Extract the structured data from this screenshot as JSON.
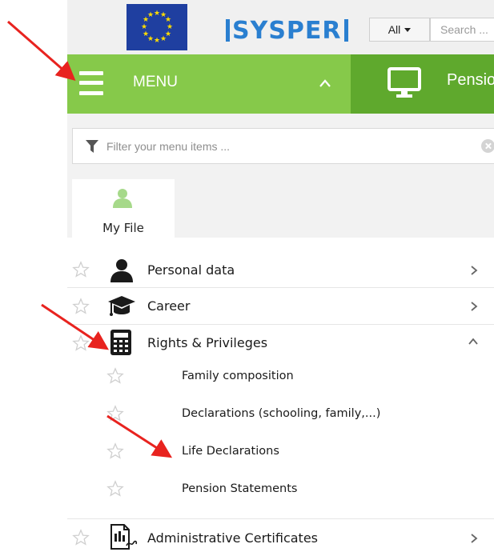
{
  "header": {
    "logo_text": "SYSPER",
    "search_scope": "All",
    "search_placeholder": "Search ..."
  },
  "menu_bar": {
    "label": "MENU",
    "pension_tab": "Pension"
  },
  "filter": {
    "placeholder": "Filter your menu items ..."
  },
  "tabs": [
    {
      "label": "My File"
    }
  ],
  "menu": {
    "items": [
      {
        "label": "Personal data",
        "icon": "person-icon",
        "expanded": false
      },
      {
        "label": "Career",
        "icon": "graduation-cap-icon",
        "expanded": false
      },
      {
        "label": "Rights & Privileges",
        "icon": "calculator-icon",
        "expanded": true,
        "children": [
          {
            "label": "Family composition"
          },
          {
            "label": "Declarations (schooling, family,...)"
          },
          {
            "label": "Life Declarations"
          },
          {
            "label": "Pension Statements"
          }
        ]
      },
      {
        "label": "Administrative Certificates",
        "icon": "certificate-icon",
        "expanded": false
      }
    ]
  },
  "colors": {
    "menu_green": "#86c94a",
    "tab_green": "#5fa92d",
    "logo_blue": "#2a7fd0",
    "eu_blue": "#1f3fa0",
    "eu_star": "#ffdd00",
    "annotation_red": "#e8231f"
  }
}
